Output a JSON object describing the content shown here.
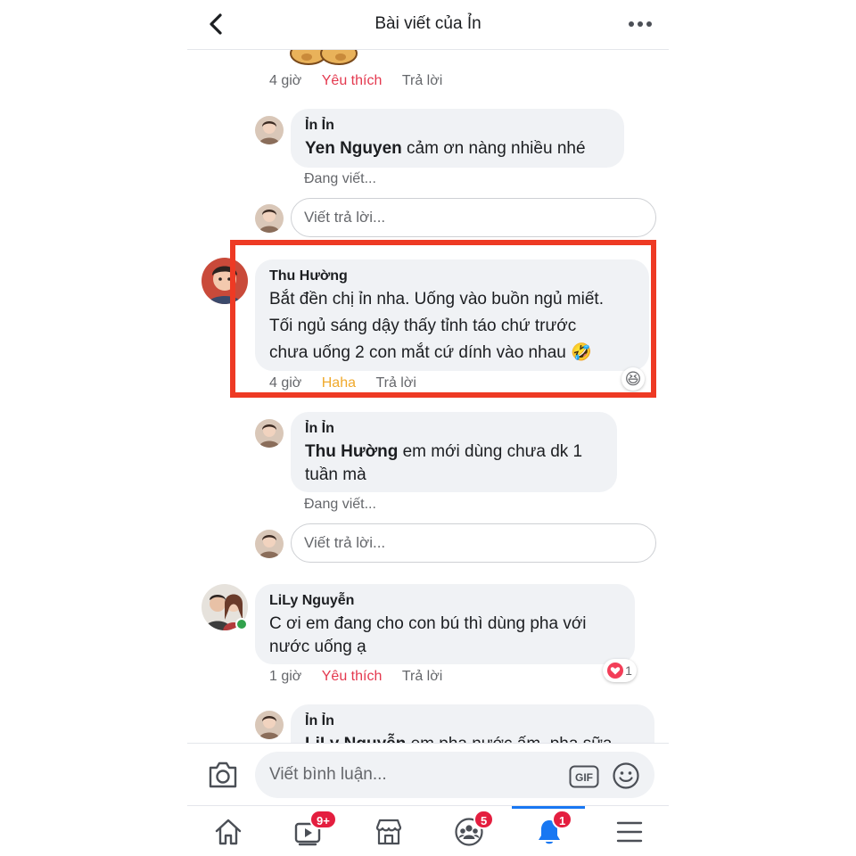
{
  "header": {
    "title": "Bài viết của Ỉn"
  },
  "comments": {
    "top_meta": {
      "time": "4 giờ",
      "like": "Yêu thích",
      "reply": "Trả lời"
    },
    "reply1": {
      "name": "Ỉn Ỉn",
      "mention": "Yen Nguyen",
      "text": " cảm ơn nàng nhiều nhé",
      "typing": "Đang viết...",
      "input_placeholder": "Viết trả lời..."
    },
    "thu": {
      "name": "Thu Hường",
      "lines": [
        "Bắt đền chị ỉn nha. Uống vào buồn ngủ miết.",
        "Tối ngủ sáng dậy thấy tỉnh táo chứ trước",
        "chưa uống 2 con mắt cứ dính vào nhau 🤣"
      ],
      "time": "4 giờ",
      "reaction": "Haha",
      "reply": "Trả lời",
      "reaction_emoji": "😆"
    },
    "reply2": {
      "name": "Ỉn Ỉn",
      "mention": "Thu Hường",
      "text_line1": " em mới dùng chưa dk 1",
      "text_line2": "tuần mà",
      "typing": "Đang viết...",
      "input_placeholder": "Viết trả lời..."
    },
    "lily": {
      "name": "LiLy Nguyễn",
      "lines": [
        "C ơi em đang cho con bú thì dùng pha với",
        "nước uống ạ"
      ],
      "time": "1 giờ",
      "like": "Yêu thích",
      "reply": "Trả lời",
      "reaction_count": "1"
    },
    "reply3": {
      "name": "Ỉn Ỉn",
      "mention": "LiLy Nguyễn",
      "text": " em pha nước ấm, pha sữa"
    }
  },
  "composer": {
    "placeholder": "Viết bình luận...",
    "gif_label": "GIF"
  },
  "nav": {
    "video_badge": "9+",
    "groups_badge": "5",
    "notif_badge": "1"
  },
  "colors": {
    "highlight": "#ee3a24",
    "like": "#e4394f",
    "haha": "#f0a92b",
    "accent": "#1877f2",
    "badge": "#e41e3f"
  }
}
